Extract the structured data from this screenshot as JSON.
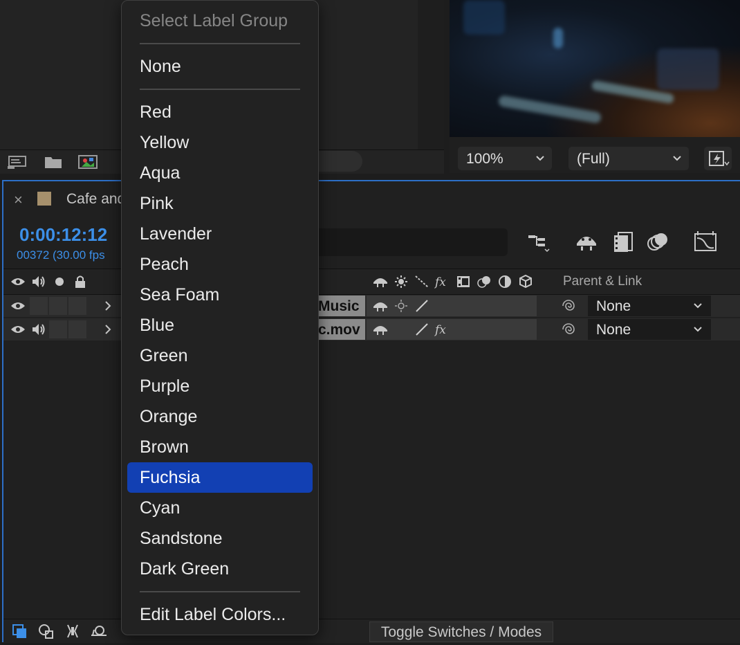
{
  "viewer": {
    "zoom": "100%",
    "resolution": "(Full)"
  },
  "timeline": {
    "close": "×",
    "comp_title": "Cafe and",
    "timecode": "0:00:12:12",
    "frame_info": "00372 (30.00 fps",
    "header": {
      "parent_link": "Parent & Link"
    },
    "layers": [
      {
        "name": "Music",
        "parent": "None"
      },
      {
        "name": "c.mov",
        "parent": "None"
      }
    ],
    "toggle_label": "Toggle Switches / Modes"
  },
  "menu": {
    "header": "Select Label Group",
    "none": "None",
    "colors": [
      "Red",
      "Yellow",
      "Aqua",
      "Pink",
      "Lavender",
      "Peach",
      "Sea Foam",
      "Blue",
      "Green",
      "Purple",
      "Orange",
      "Brown",
      "Fuchsia",
      "Cyan",
      "Sandstone",
      "Dark Green"
    ],
    "selected": "Fuchsia",
    "edit": "Edit Label Colors..."
  },
  "colors": {
    "accent": "#2d6fc7",
    "timecode": "#3c8fe8",
    "highlight": "#1240b3",
    "comp_label": "#a6906c"
  }
}
